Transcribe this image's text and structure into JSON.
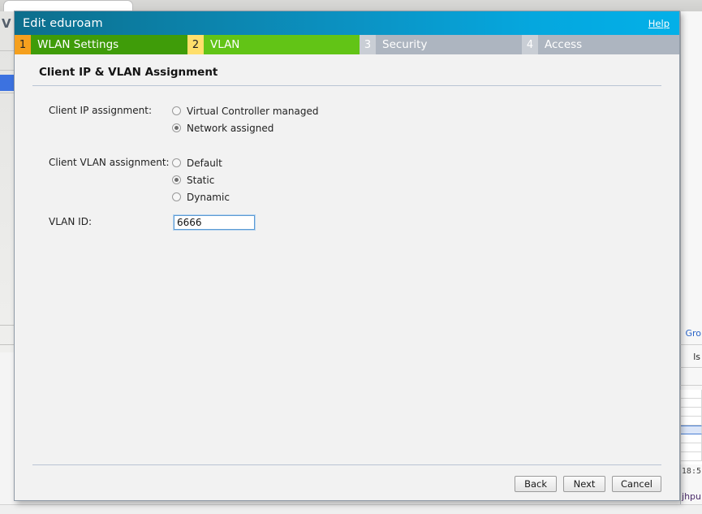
{
  "dialog": {
    "title": "Edit eduroam",
    "help_label": "Help",
    "steps": [
      {
        "number": "1",
        "label": "WLAN Settings",
        "state": "done"
      },
      {
        "number": "2",
        "label": "VLAN",
        "state": "active"
      },
      {
        "number": "3",
        "label": "Security",
        "state": "todo"
      },
      {
        "number": "4",
        "label": "Access",
        "state": "todo"
      }
    ],
    "section_heading": "Client IP & VLAN Assignment",
    "fields": {
      "client_ip": {
        "label": "Client IP assignment:",
        "options": [
          {
            "label": "Virtual Controller managed",
            "selected": false
          },
          {
            "label": "Network assigned",
            "selected": true
          }
        ]
      },
      "client_vlan": {
        "label": "Client VLAN assignment:",
        "options": [
          {
            "label": "Default",
            "selected": false
          },
          {
            "label": "Static",
            "selected": true
          },
          {
            "label": "Dynamic",
            "selected": false
          }
        ]
      },
      "vlan_id": {
        "label": "VLAN ID:",
        "value": "6666",
        "placeholder": ""
      }
    },
    "footer": {
      "back_label": "Back",
      "next_label": "Next",
      "cancel_label": "Cancel"
    },
    "colors": {
      "title_bar_start": "#0d6e8c",
      "title_bar_end": "#03b0e8",
      "step_done_num": "#f5a01e",
      "step_done_bg": "#3f9c09",
      "step_active_num": "#ffdf6b",
      "step_active_bg": "#62c416",
      "step_todo_num": "#c9ced5",
      "step_todo_bg": "#adb5c0",
      "focus_border": "#5b9bd5"
    }
  },
  "background": {
    "left_pane_title": "V",
    "right_link": "Gro",
    "right_text": "ls",
    "timestamp": "18:5",
    "bottom_text": "jhpu"
  }
}
